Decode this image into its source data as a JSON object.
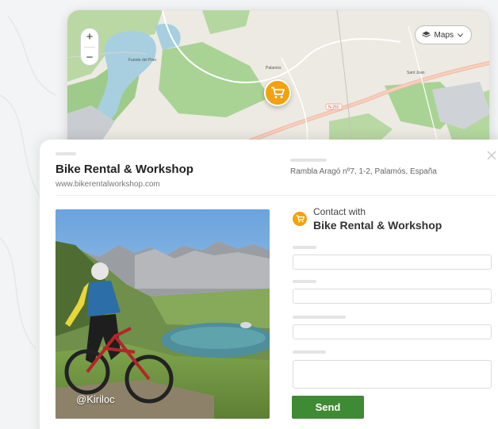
{
  "map": {
    "zoom_in_label": "+",
    "zoom_out_label": "−",
    "layers_button_label": "Maps",
    "layers_icon": "layers-icon",
    "pin_icon": "cart-icon",
    "place_labels": {
      "town1": "Palamós",
      "town2": "Sant Joan",
      "road": "N-260",
      "top_left": "Fuente del Pino"
    }
  },
  "business": {
    "name": "Bike Rental & Workshop",
    "url": "www.bikerentalworkshop.com",
    "address": "Rambla Aragó nº7, 1-2, Palamós, España"
  },
  "photo": {
    "credit": "@Kiriloc"
  },
  "contact": {
    "heading": "Contact with",
    "business_name": "Bike Rental & Workshop",
    "icon": "cart-icon",
    "send_label": "Send"
  },
  "colors": {
    "accent_orange": "#f5a00f",
    "send_green": "#3f8a34"
  }
}
